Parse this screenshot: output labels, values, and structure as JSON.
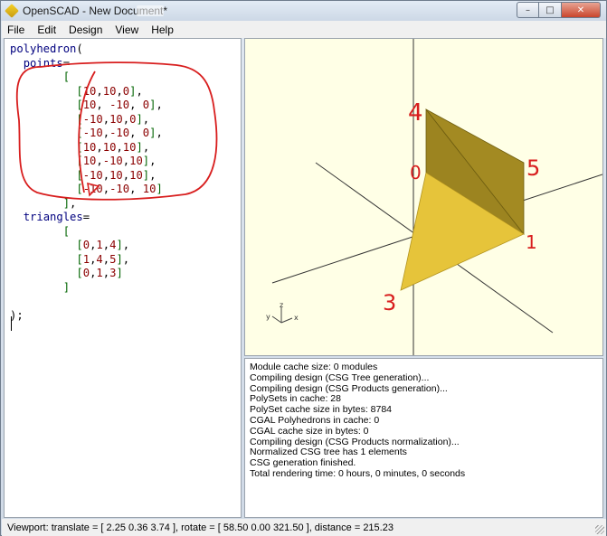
{
  "window": {
    "title": "OpenSCAD - New Document*",
    "controls": {
      "minimize": "–",
      "maximize": "□",
      "close": "✕"
    }
  },
  "menu": [
    "File",
    "Edit",
    "Design",
    "View",
    "Help"
  ],
  "editor": {
    "lines": [
      "polyhedron(",
      "  points=",
      "        [",
      "          [10,10,0],",
      "          [10, -10, 0],",
      "          [-10,10,0],",
      "          [-10,-10, 0],",
      "          [10,10,10],",
      "          [10,-10,10],",
      "          [-10,10,10],",
      "          [-10,-10, 10]",
      "        ],",
      "  triangles=",
      "        [",
      "          [0,1,4],",
      "          [1,4,5],",
      "          [0,1,3]",
      "        ]",
      "",
      ");"
    ]
  },
  "viewer": {
    "background": "#ffffe6",
    "axis_labels": {
      "z": "z",
      "y": "y",
      "x": "x"
    },
    "handwritten_labels": [
      "4",
      "5",
      "0",
      "1",
      "3"
    ]
  },
  "console": {
    "lines": [
      "Module cache size: 0 modules",
      "Compiling design (CSG Tree generation)...",
      "Compiling design (CSG Products generation)...",
      "PolySets in cache: 28",
      "PolySet cache size in bytes: 8784",
      "CGAL Polyhedrons in cache: 0",
      "CGAL cache size in bytes: 0",
      "Compiling design (CSG Products normalization)...",
      "Normalized CSG tree has 1 elements",
      "CSG generation finished.",
      "Total rendering time: 0 hours, 0 minutes, 0 seconds"
    ]
  },
  "status": {
    "text": "Viewport: translate = [ 2.25 0.36 3.74 ], rotate = [ 58.50 0.00 321.50 ], distance = 215.23"
  },
  "colors": {
    "face_light": "#e6c43a",
    "face_dark": "#9c8420",
    "annotation": "#d81e1e"
  }
}
